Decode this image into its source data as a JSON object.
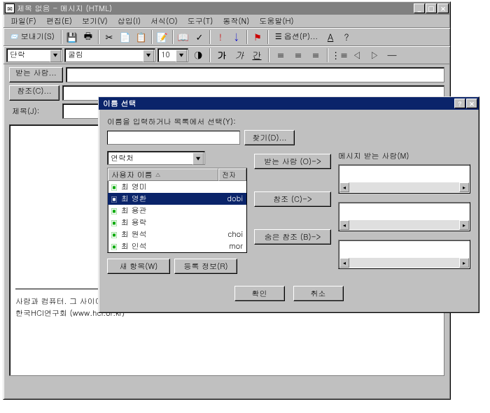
{
  "main_window": {
    "title": "제목 없음 - 메시지 (HTML)",
    "menu": [
      "파일(F)",
      "편집(E)",
      "보기(V)",
      "삽입(I)",
      "서식(O)",
      "도구(T)",
      "동작(N)",
      "도움말(H)"
    ],
    "send_label": "보내기(S)",
    "options_label": "옵션(P)...",
    "style_combo": "단락",
    "font_combo": "굴림",
    "size_combo": "10",
    "to_btn": "받는 사람...",
    "cc_btn": "참조(C)...",
    "subject_label": "제목(J):",
    "sig_line1": "사람과 컴퓨터. 그 사이에 HCI 연구회가 있습니다.",
    "sig_line2": "한국HCI연구회 (www.hci.or.kr)"
  },
  "dialog": {
    "title": "이름 선택",
    "prompt": "이름을 입력하거나 목록에서 선택(Y):",
    "find_btn": "찾기(D)...",
    "source_combo": "연락처",
    "recipients_label": "메시지 받는 사람(M)",
    "col_name": "사용자 이름",
    "col_email": "전자",
    "rows": [
      {
        "name": "최 영미",
        "email": ""
      },
      {
        "name": "최 영환",
        "email": "dobi"
      },
      {
        "name": "최 용관",
        "email": ""
      },
      {
        "name": "최 용락",
        "email": ""
      },
      {
        "name": "최 원석",
        "email": "choi"
      },
      {
        "name": "최 인석",
        "email": "mor"
      }
    ],
    "to_btn": "받는 사람 (O)->",
    "cc_btn": "참조 (C)->",
    "bcc_btn": "숨은 참조 (B)->",
    "new_btn": "새 항목(W)",
    "prop_btn": "등록 정보(R)",
    "ok_btn": "확인",
    "cancel_btn": "취소"
  }
}
